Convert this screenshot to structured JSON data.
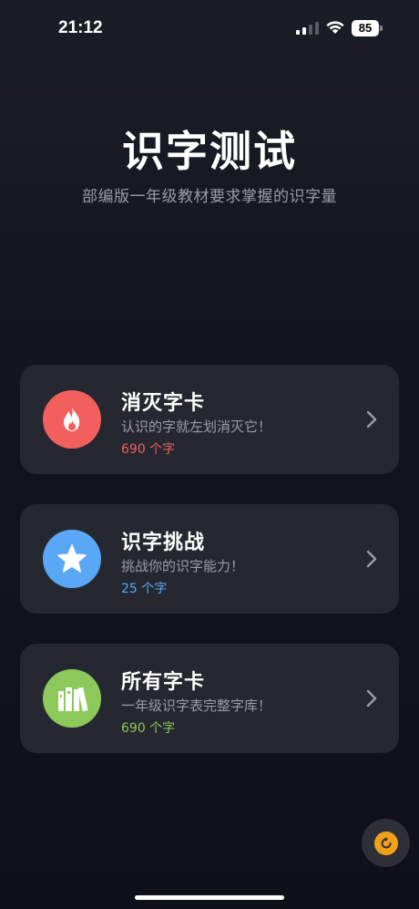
{
  "status_bar": {
    "time": "21:12",
    "battery": "85",
    "icons": [
      "signal-icon",
      "wifi-icon",
      "battery-icon"
    ]
  },
  "header": {
    "title": "识字测试",
    "subtitle": "部编版一年级教材要求掌握的识字量"
  },
  "cards": [
    {
      "title": "消灭字卡",
      "description": "认识的字就左划消灭它！",
      "count": "690 个字",
      "icon": "flame-icon",
      "icon_color": "#f25f5c",
      "count_color": "#f25f5c"
    },
    {
      "title": "识字挑战",
      "description": "挑战你的识字能力！",
      "count": "25 个字",
      "icon": "star-icon",
      "icon_color": "#5aa8f5",
      "count_color": "#5aa8f5"
    },
    {
      "title": "所有字卡",
      "description": "一年级识字表完整字库！",
      "count": "690 个字",
      "icon": "books-icon",
      "icon_color": "#8cc95a",
      "count_color": "#8cc95a"
    }
  ],
  "fab": {
    "icon": "refresh-icon",
    "color": "#f2a019"
  }
}
